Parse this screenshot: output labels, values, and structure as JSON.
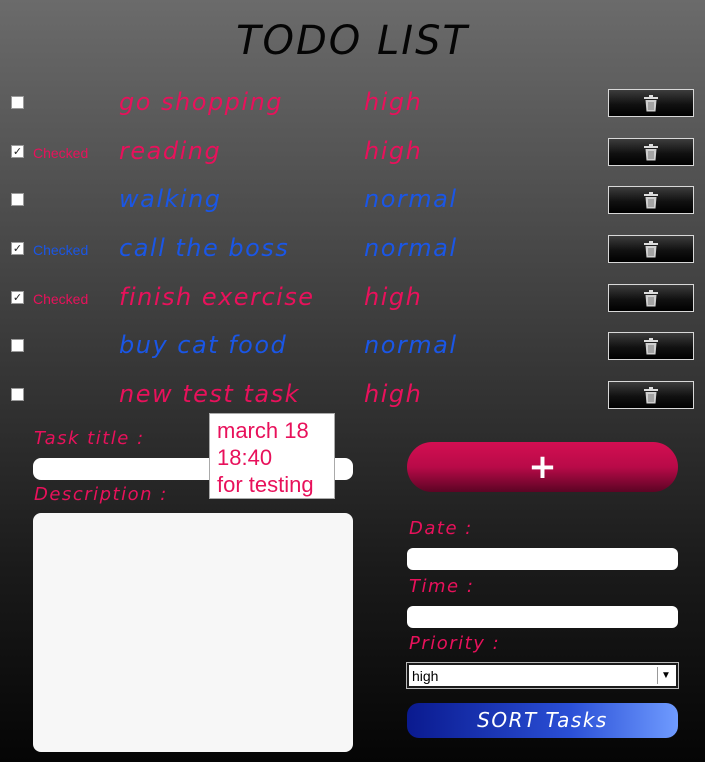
{
  "title": "TODO LIST",
  "tasks": [
    {
      "checked": false,
      "checked_label": "",
      "name": "go shopping",
      "priority": "high"
    },
    {
      "checked": true,
      "checked_label": "Checked",
      "name": "reading",
      "priority": "high"
    },
    {
      "checked": false,
      "checked_label": "",
      "name": "walking",
      "priority": "normal"
    },
    {
      "checked": true,
      "checked_label": "Checked",
      "name": "call the boss",
      "priority": "normal"
    },
    {
      "checked": true,
      "checked_label": "Checked",
      "name": "finish exercise",
      "priority": "high"
    },
    {
      "checked": false,
      "checked_label": "",
      "name": "buy cat food",
      "priority": "normal"
    },
    {
      "checked": false,
      "checked_label": "",
      "name": "new test task",
      "priority": "high"
    }
  ],
  "form": {
    "task_title_label": "Task title :",
    "description_label": "Description :",
    "date_label": "Date :",
    "time_label": "Time :",
    "priority_label": "Priority :",
    "priority_value": "high",
    "add_label": "+",
    "sort_label": "SORT Tasks"
  },
  "tooltip": {
    "line1": "march 18",
    "line2": "18:40",
    "line3": "for testing"
  },
  "colors": {
    "high": "#e8115b",
    "normal": "#1a56e6"
  },
  "icons": {
    "delete": "trash-icon",
    "dropdown": "dropdown-arrow-icon"
  }
}
